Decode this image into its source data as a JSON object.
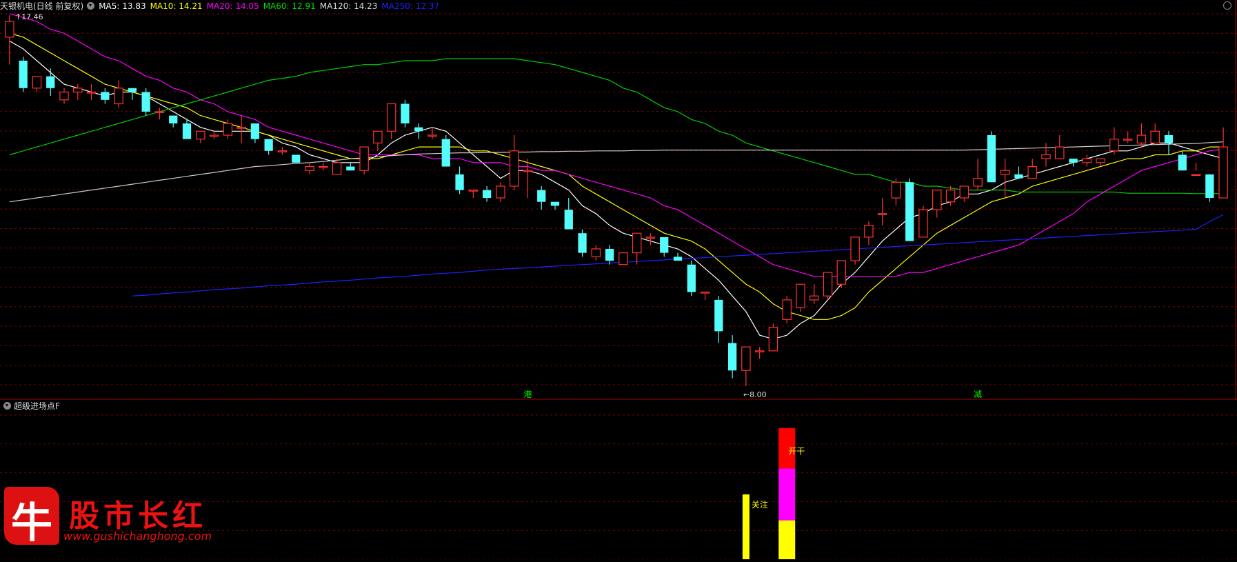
{
  "main_header": {
    "title": "天银机电(日线 前复权)",
    "ma": [
      {
        "label": "MA5: 13.83",
        "color": "#ffffff"
      },
      {
        "label": "MA10: 14.21",
        "color": "#ffff00"
      },
      {
        "label": "MA20: 14.05",
        "color": "#ff00ff"
      },
      {
        "label": "MA60: 12.91",
        "color": "#00e000"
      },
      {
        "label": "MA120: 14.23",
        "color": "#dddddd"
      },
      {
        "label": "MA250: 12.37",
        "color": "#2020ff"
      }
    ]
  },
  "price_labels": {
    "high": "17.46",
    "low": "8.00",
    "low_arrow": "←"
  },
  "markers": [
    {
      "text": "港",
      "idx": 38
    },
    {
      "text": "减",
      "idx": 71
    }
  ],
  "sub_header": {
    "title": "超级进场点F"
  },
  "signals": [
    {
      "text": "关注",
      "color": "#ffff00"
    },
    {
      "text": "开干",
      "color": "#ffff00"
    }
  ],
  "logo": {
    "mark": "牛",
    "name": "股市长红",
    "url": "www.gushichanghong.com"
  },
  "colors": {
    "up": "#ff3232",
    "down": "#54fcfc",
    "grid": "#7a0000",
    "bg": "#000000"
  },
  "chart_data": {
    "type": "candlestick",
    "y_range": [
      8.0,
      17.46
    ],
    "candles": [
      [
        16.9,
        17.46,
        17.3,
        16.2
      ],
      [
        16.3,
        16.4,
        15.6,
        15.5
      ],
      [
        15.6,
        15.9,
        15.9,
        15.5
      ],
      [
        15.9,
        16.1,
        15.6,
        15.4
      ],
      [
        15.3,
        15.6,
        15.5,
        15.2
      ],
      [
        15.5,
        15.7,
        15.6,
        15.3
      ],
      [
        15.5,
        15.7,
        15.5,
        15.3
      ],
      [
        15.5,
        15.6,
        15.3,
        15.2
      ],
      [
        15.2,
        15.8,
        15.6,
        15.1
      ],
      [
        15.6,
        15.6,
        15.5,
        15.3
      ],
      [
        15.5,
        15.6,
        15.0,
        14.9
      ],
      [
        15.0,
        15.1,
        15.0,
        14.8
      ],
      [
        14.9,
        14.9,
        14.7,
        14.6
      ],
      [
        14.7,
        14.8,
        14.3,
        14.3
      ],
      [
        14.3,
        14.5,
        14.5,
        14.2
      ],
      [
        14.4,
        14.5,
        14.4,
        14.3
      ],
      [
        14.4,
        14.8,
        14.7,
        14.3
      ],
      [
        14.6,
        14.9,
        14.6,
        14.2
      ],
      [
        14.7,
        14.7,
        14.3,
        14.2
      ],
      [
        14.3,
        14.3,
        14.0,
        13.9
      ],
      [
        14.0,
        14.1,
        14.0,
        13.9
      ],
      [
        13.9,
        13.9,
        13.7,
        13.7
      ],
      [
        13.5,
        13.7,
        13.6,
        13.4
      ],
      [
        13.6,
        13.7,
        13.6,
        13.5
      ],
      [
        13.4,
        13.8,
        13.7,
        13.4
      ],
      [
        13.6,
        13.7,
        13.5,
        13.5
      ],
      [
        13.5,
        14.1,
        14.1,
        13.4
      ],
      [
        14.2,
        14.5,
        14.5,
        14.0
      ],
      [
        14.5,
        15.2,
        15.2,
        14.3
      ],
      [
        15.2,
        15.3,
        14.7,
        14.6
      ],
      [
        14.6,
        14.7,
        14.5,
        14.3
      ],
      [
        14.4,
        14.6,
        14.4,
        14.3
      ],
      [
        14.3,
        14.4,
        13.6,
        13.6
      ],
      [
        13.4,
        13.6,
        13.0,
        12.9
      ],
      [
        13.0,
        13.0,
        13.0,
        12.8
      ],
      [
        13.0,
        13.1,
        12.8,
        12.7
      ],
      [
        12.8,
        13.2,
        13.1,
        12.7
      ],
      [
        13.1,
        14.4,
        14.0,
        13.0
      ],
      [
        13.5,
        13.8,
        13.5,
        12.8
      ],
      [
        13.0,
        13.1,
        12.7,
        12.5
      ],
      [
        12.7,
        12.7,
        12.6,
        12.5
      ],
      [
        12.5,
        12.8,
        12.0,
        12.0
      ],
      [
        11.9,
        12.0,
        11.4,
        11.3
      ],
      [
        11.3,
        11.6,
        11.5,
        11.2
      ],
      [
        11.5,
        11.6,
        11.2,
        11.1
      ],
      [
        11.1,
        11.3,
        11.4,
        11.1
      ],
      [
        11.4,
        11.9,
        11.9,
        11.1
      ],
      [
        11.8,
        11.9,
        11.8,
        11.6
      ],
      [
        11.8,
        11.8,
        11.4,
        11.3
      ],
      [
        11.3,
        11.4,
        11.2,
        11.2
      ],
      [
        11.1,
        11.2,
        10.4,
        10.3
      ],
      [
        10.4,
        10.4,
        10.4,
        10.2
      ],
      [
        10.2,
        10.3,
        9.4,
        9.1
      ],
      [
        9.1,
        9.3,
        8.4,
        8.2
      ],
      [
        8.4,
        8.4,
        9.0,
        8.0
      ],
      [
        8.9,
        9.0,
        8.9,
        8.7
      ],
      [
        8.9,
        9.6,
        9.5,
        8.9
      ],
      [
        9.7,
        10.3,
        10.2,
        9.6
      ],
      [
        10.0,
        10.6,
        10.6,
        9.9
      ],
      [
        10.2,
        10.6,
        10.3,
        10.1
      ],
      [
        10.3,
        10.9,
        10.9,
        10.2
      ],
      [
        10.6,
        11.2,
        11.2,
        10.5
      ],
      [
        11.2,
        11.8,
        11.8,
        11.1
      ],
      [
        11.8,
        12.2,
        12.1,
        11.6
      ],
      [
        12.4,
        12.8,
        12.4,
        12.1
      ],
      [
        12.8,
        13.3,
        13.2,
        12.6
      ],
      [
        13.2,
        13.3,
        11.7,
        11.7
      ],
      [
        11.8,
        12.6,
        12.5,
        11.8
      ],
      [
        12.5,
        13.0,
        13.0,
        12.3
      ],
      [
        12.7,
        13.1,
        13.0,
        12.6
      ],
      [
        12.8,
        13.1,
        13.1,
        12.7
      ],
      [
        13.1,
        13.8,
        13.3,
        13.0
      ],
      [
        14.4,
        14.5,
        13.2,
        13.2
      ],
      [
        13.4,
        13.8,
        13.5,
        12.8
      ],
      [
        13.4,
        13.6,
        13.3,
        13.3
      ],
      [
        13.3,
        13.8,
        13.6,
        13.3
      ],
      [
        13.8,
        14.2,
        13.9,
        13.6
      ],
      [
        13.8,
        14.4,
        14.1,
        13.8
      ],
      [
        13.8,
        13.8,
        13.7,
        13.6
      ],
      [
        13.7,
        13.9,
        13.8,
        13.6
      ],
      [
        13.7,
        13.8,
        13.8,
        13.6
      ],
      [
        14.0,
        14.6,
        14.3,
        13.9
      ],
      [
        14.3,
        14.5,
        14.3,
        14.2
      ],
      [
        14.2,
        14.7,
        14.4,
        14.1
      ],
      [
        14.2,
        14.7,
        14.5,
        14.2
      ],
      [
        14.4,
        14.5,
        14.2,
        13.9
      ],
      [
        13.9,
        14.0,
        13.5,
        13.5
      ],
      [
        13.4,
        13.7,
        13.4,
        13.5
      ],
      [
        13.4,
        13.4,
        12.8,
        12.7
      ],
      [
        12.8,
        14.6,
        14.1,
        12.8
      ]
    ],
    "ma_series": {
      "MA5": [
        16.8,
        16.6,
        16.3,
        16.0,
        15.7,
        15.6,
        15.5,
        15.4,
        15.5,
        15.5,
        15.4,
        15.2,
        15.0,
        14.8,
        14.6,
        14.5,
        14.5,
        14.5,
        14.5,
        14.4,
        14.2,
        14.1,
        13.9,
        13.8,
        13.7,
        13.7,
        13.7,
        13.9,
        14.2,
        14.4,
        14.5,
        14.6,
        14.5,
        14.2,
        13.9,
        13.6,
        13.3,
        13.5,
        13.5,
        13.4,
        13.2,
        13.0,
        12.6,
        12.4,
        12.1,
        11.9,
        11.8,
        11.7,
        11.6,
        11.5,
        11.3,
        11.0,
        10.7,
        10.3,
        9.9,
        9.3,
        9.2,
        9.3,
        9.6,
        9.8,
        10.2,
        10.6,
        10.9,
        11.3,
        11.7,
        12.0,
        12.3,
        12.4,
        12.6,
        12.7,
        12.9,
        12.9,
        13.0,
        13.2,
        13.3,
        13.4,
        13.5,
        13.6,
        13.7,
        13.8,
        13.9,
        14.0,
        14.0,
        14.1,
        14.2,
        14.2,
        14.1,
        14.0,
        13.9,
        13.8
      ],
      "MA10": [
        17.0,
        16.9,
        16.7,
        16.5,
        16.3,
        16.1,
        15.9,
        15.7,
        15.6,
        15.5,
        15.4,
        15.3,
        15.2,
        15.1,
        14.9,
        14.8,
        14.7,
        14.6,
        14.5,
        14.4,
        14.3,
        14.2,
        14.1,
        14.0,
        13.9,
        13.8,
        13.8,
        13.8,
        13.9,
        14.0,
        14.1,
        14.1,
        14.1,
        14.1,
        14.0,
        14.0,
        13.9,
        13.8,
        13.7,
        13.6,
        13.5,
        13.4,
        13.1,
        12.9,
        12.7,
        12.5,
        12.3,
        12.1,
        11.9,
        11.8,
        11.7,
        11.5,
        11.2,
        10.9,
        10.6,
        10.4,
        10.1,
        9.9,
        9.8,
        9.7,
        9.7,
        9.8,
        10.0,
        10.4,
        10.7,
        11.0,
        11.3,
        11.6,
        11.9,
        12.1,
        12.3,
        12.5,
        12.7,
        12.8,
        12.9,
        13.1,
        13.2,
        13.3,
        13.4,
        13.5,
        13.6,
        13.7,
        13.8,
        13.8,
        13.9,
        13.9,
        14.0,
        14.0,
        14.1,
        14.1
      ],
      "MA20": [
        17.5,
        17.4,
        17.3,
        17.1,
        17.0,
        16.8,
        16.6,
        16.4,
        16.3,
        16.1,
        15.9,
        15.8,
        15.6,
        15.5,
        15.3,
        15.2,
        15.0,
        14.9,
        14.8,
        14.6,
        14.5,
        14.4,
        14.3,
        14.2,
        14.1,
        14.0,
        13.9,
        13.9,
        13.9,
        13.9,
        13.9,
        13.8,
        13.8,
        13.8,
        13.7,
        13.7,
        13.7,
        13.6,
        13.6,
        13.5,
        13.5,
        13.4,
        13.3,
        13.2,
        13.1,
        13.0,
        12.9,
        12.8,
        12.6,
        12.5,
        12.3,
        12.1,
        11.9,
        11.7,
        11.5,
        11.3,
        11.1,
        11.0,
        10.9,
        10.8,
        10.8,
        10.8,
        10.8,
        10.8,
        10.8,
        10.8,
        10.9,
        10.9,
        11.0,
        11.1,
        11.2,
        11.3,
        11.4,
        11.5,
        11.6,
        11.8,
        12.0,
        12.2,
        12.4,
        12.7,
        12.9,
        13.1,
        13.3,
        13.5,
        13.6,
        13.7,
        13.8,
        13.9,
        14.0,
        14.05
      ],
      "MA60": [
        13.9,
        14.0,
        14.1,
        14.2,
        14.3,
        14.4,
        14.5,
        14.6,
        14.7,
        14.8,
        14.9,
        15.0,
        15.1,
        15.2,
        15.3,
        15.4,
        15.5,
        15.6,
        15.7,
        15.8,
        15.85,
        15.9,
        16.0,
        16.05,
        16.1,
        16.15,
        16.2,
        16.2,
        16.25,
        16.3,
        16.3,
        16.3,
        16.35,
        16.35,
        16.35,
        16.35,
        16.35,
        16.35,
        16.3,
        16.25,
        16.2,
        16.1,
        16.0,
        15.9,
        15.8,
        15.6,
        15.5,
        15.3,
        15.1,
        15.0,
        14.8,
        14.7,
        14.5,
        14.4,
        14.2,
        14.1,
        14.0,
        13.9,
        13.8,
        13.7,
        13.6,
        13.5,
        13.4,
        13.4,
        13.3,
        13.2,
        13.2,
        13.1,
        13.1,
        13.05,
        13.0,
        13.0,
        13.0,
        13.0,
        12.95,
        12.95,
        12.95,
        12.95,
        12.95,
        12.95,
        12.95,
        12.95,
        12.92,
        12.92,
        12.92,
        12.92,
        12.92,
        12.91,
        12.91,
        12.91
      ],
      "MA120": [
        12.7,
        12.75,
        12.8,
        12.85,
        12.9,
        12.95,
        13.0,
        13.05,
        13.1,
        13.15,
        13.2,
        13.25,
        13.3,
        13.35,
        13.4,
        13.45,
        13.5,
        13.55,
        13.6,
        13.62,
        13.65,
        13.68,
        13.7,
        13.73,
        13.76,
        13.8,
        13.82,
        13.85,
        13.88,
        13.9,
        13.92,
        13.93,
        13.94,
        13.95,
        13.95,
        13.96,
        13.96,
        13.97,
        13.97,
        13.98,
        13.98,
        13.99,
        13.99,
        14.0,
        14.0,
        14.0,
        14.01,
        14.01,
        14.02,
        14.02,
        14.02,
        14.02,
        14.02,
        14.02,
        14.02,
        14.02,
        14.02,
        14.02,
        14.02,
        14.02,
        14.02,
        14.02,
        14.02,
        14.02,
        14.02,
        14.02,
        14.02,
        14.02,
        14.02,
        14.02,
        14.02,
        14.03,
        14.04,
        14.05,
        14.06,
        14.07,
        14.08,
        14.09,
        14.1,
        14.11,
        14.12,
        14.13,
        14.14,
        14.15,
        14.16,
        14.17,
        14.18,
        14.19,
        14.21,
        14.23
      ],
      "MA250": [
        null,
        null,
        null,
        null,
        null,
        null,
        null,
        null,
        null,
        10.3,
        10.32,
        10.35,
        10.38,
        10.4,
        10.43,
        10.46,
        10.48,
        10.5,
        10.53,
        10.56,
        10.58,
        10.6,
        10.63,
        10.66,
        10.68,
        10.7,
        10.73,
        10.76,
        10.78,
        10.8,
        10.83,
        10.86,
        10.88,
        10.9,
        10.93,
        10.96,
        10.98,
        11.0,
        11.02,
        11.04,
        11.06,
        11.08,
        11.1,
        11.12,
        11.14,
        11.16,
        11.18,
        11.2,
        11.22,
        11.24,
        11.26,
        11.28,
        11.3,
        11.32,
        11.34,
        11.36,
        11.38,
        11.4,
        11.42,
        11.44,
        11.46,
        11.48,
        11.5,
        11.52,
        11.54,
        11.56,
        11.58,
        11.6,
        11.62,
        11.64,
        11.66,
        11.68,
        11.7,
        11.72,
        11.74,
        11.76,
        11.78,
        11.8,
        11.82,
        11.84,
        11.86,
        11.88,
        11.9,
        11.92,
        11.94,
        11.96,
        11.98,
        12.0,
        12.2,
        12.37
      ]
    },
    "indicator_bars": [
      {
        "idx": 54,
        "segments": [
          {
            "from": 0,
            "to": 0.45,
            "color": "#ffff00"
          }
        ]
      },
      {
        "idx": 57,
        "segments": [
          {
            "from": 0,
            "to": 0.27,
            "color": "#ffff00"
          },
          {
            "from": 0.27,
            "to": 0.63,
            "color": "#ff00ff"
          },
          {
            "from": 0.63,
            "to": 0.91,
            "color": "#ff0000"
          }
        ]
      }
    ],
    "indicator_range": [
      0,
      1
    ]
  }
}
